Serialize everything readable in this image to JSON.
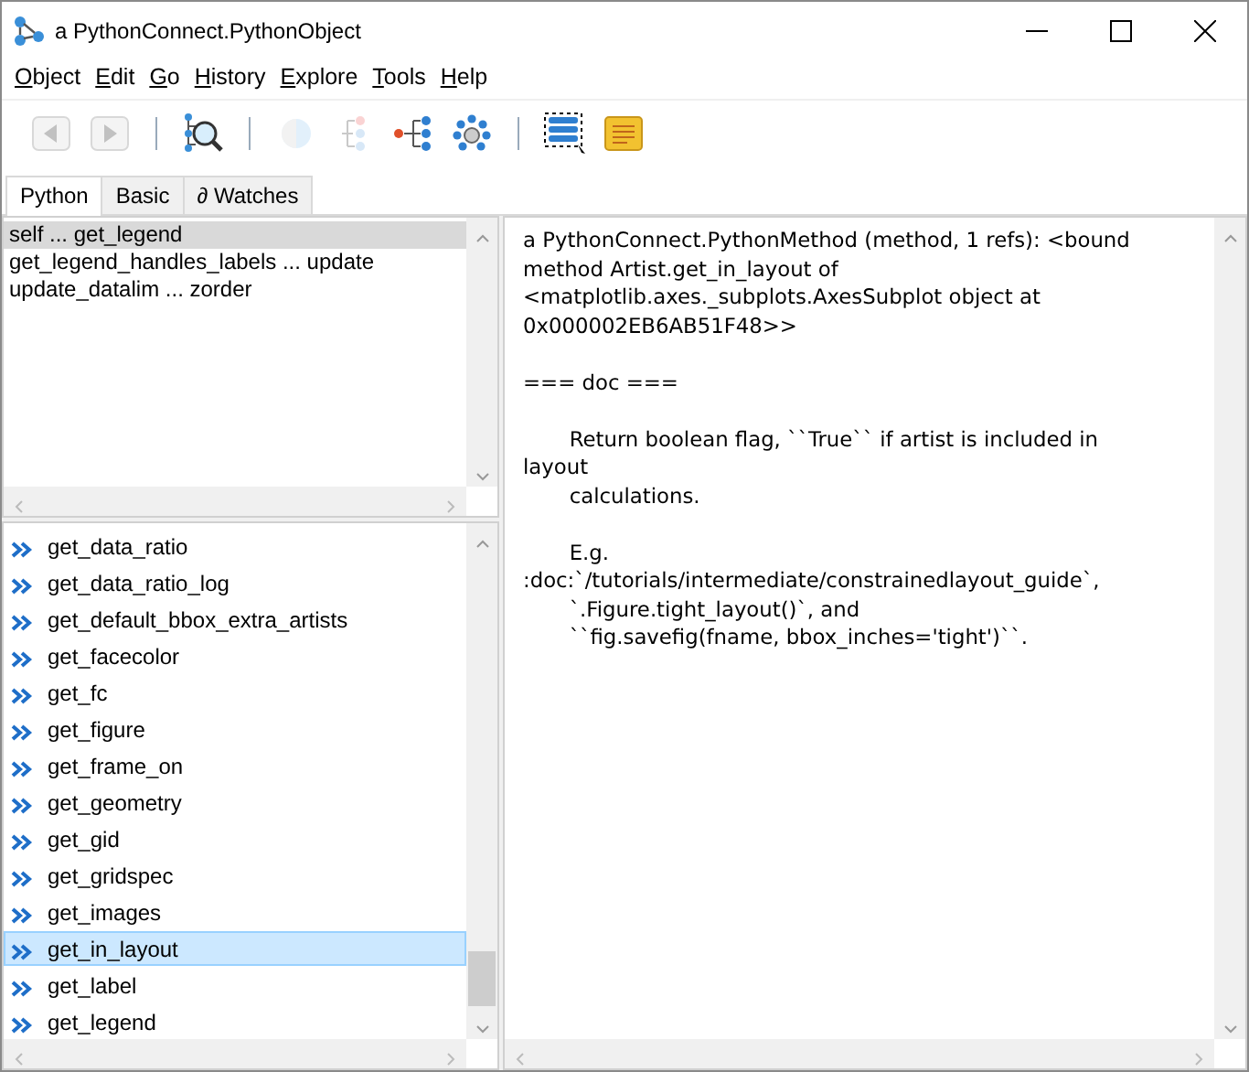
{
  "window": {
    "title": "a PythonConnect.PythonObject"
  },
  "menu": [
    {
      "label": "Object"
    },
    {
      "label": "Edit"
    },
    {
      "label": "Go"
    },
    {
      "label": "History"
    },
    {
      "label": "Explore"
    },
    {
      "label": "Tools"
    },
    {
      "label": "Help"
    }
  ],
  "toolbar": [
    {
      "kind": "back",
      "disabled": true
    },
    {
      "kind": "forward",
      "disabled": true
    },
    {
      "kind": "separator"
    },
    {
      "kind": "inspect",
      "disabled": false
    },
    {
      "kind": "separator"
    },
    {
      "kind": "sphere",
      "disabled": true
    },
    {
      "kind": "tree",
      "disabled": true
    },
    {
      "kind": "graph",
      "disabled": false
    },
    {
      "kind": "cluster",
      "disabled": false
    },
    {
      "kind": "separator"
    },
    {
      "kind": "list",
      "disabled": false
    },
    {
      "kind": "note",
      "disabled": false
    }
  ],
  "tabs": [
    {
      "label": "Python",
      "selected": true
    },
    {
      "label": "Basic",
      "selected": false
    },
    {
      "label": "∂ Watches",
      "selected": false
    }
  ],
  "ranges": [
    {
      "label": "self ... get_legend",
      "selected": true
    },
    {
      "label": "get_legend_handles_labels ... update",
      "selected": false
    },
    {
      "label": "update_datalim ... zorder",
      "selected": false
    }
  ],
  "members": [
    {
      "label": "get_data_ratio",
      "selected": false
    },
    {
      "label": "get_data_ratio_log",
      "selected": false
    },
    {
      "label": "get_default_bbox_extra_artists",
      "selected": false
    },
    {
      "label": "get_facecolor",
      "selected": false
    },
    {
      "label": "get_fc",
      "selected": false
    },
    {
      "label": "get_figure",
      "selected": false
    },
    {
      "label": "get_frame_on",
      "selected": false
    },
    {
      "label": "get_geometry",
      "selected": false
    },
    {
      "label": "get_gid",
      "selected": false
    },
    {
      "label": "get_gridspec",
      "selected": false
    },
    {
      "label": "get_images",
      "selected": false
    },
    {
      "label": "get_in_layout",
      "selected": true
    },
    {
      "label": "get_label",
      "selected": false
    },
    {
      "label": "get_legend",
      "selected": false
    }
  ],
  "details": {
    "paragraphs": [
      {
        "lines": [
          "a PythonConnect.PythonMethod (method, 1 refs): <bound",
          "method Artist.get_in_layout of",
          "<matplotlib.axes._subplots.AxesSubplot object at",
          "0x000002EB6AB51F48>>"
        ]
      },
      {
        "lines": [
          "=== doc ==="
        ]
      },
      {
        "lines": [
          "       Return boolean flag, ``True`` if artist is included in",
          "layout",
          "       calculations."
        ]
      },
      {
        "lines": [
          "       E.g.",
          ":doc:`/tutorials/intermediate/constrainedlayout_guide`,",
          "       `.Figure.tight_layout()`, and",
          "       ``fig.savefig(fname, bbox_inches='tight')``."
        ]
      }
    ]
  }
}
